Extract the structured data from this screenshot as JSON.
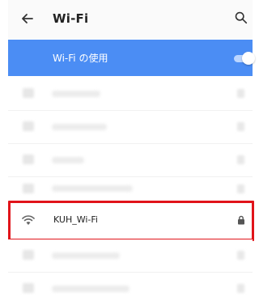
{
  "header": {
    "title": "Wi-Fi",
    "back_icon": "arrow-left-icon",
    "search_icon": "search-icon"
  },
  "wifi_toggle": {
    "label": "Wi-Fi の使用",
    "state": "on",
    "accent": "#4b8df4"
  },
  "networks": [
    {
      "name": "KUH_Wi-Fi",
      "signal_icon": "wifi-icon",
      "secured": true,
      "lock_icon": "lock-icon"
    }
  ],
  "highlight_color": "#e1141a"
}
